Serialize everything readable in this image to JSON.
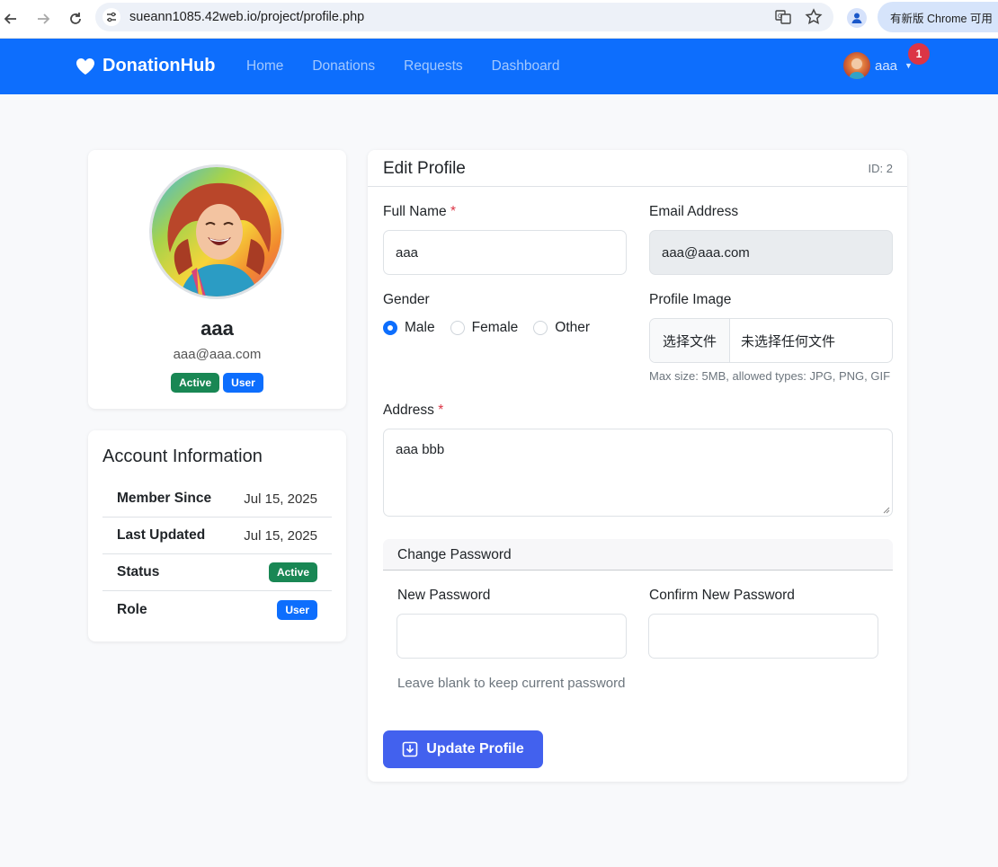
{
  "browser": {
    "url": "sueann1085.42web.io/project/profile.php",
    "update_banner": "有新版 Chrome 可用"
  },
  "navbar": {
    "brand": "DonationHub",
    "links": [
      "Home",
      "Donations",
      "Requests",
      "Dashboard"
    ],
    "username": "aaa",
    "notification_count": "1",
    "color": "#0d6efd"
  },
  "profile": {
    "name": "aaa",
    "email": "aaa@aaa.com",
    "status_badge": "Active",
    "role_badge": "User"
  },
  "account": {
    "title": "Account Information",
    "rows": [
      {
        "label": "Member Since",
        "value": "Jul 15, 2025"
      },
      {
        "label": "Last Updated",
        "value": "Jul 15, 2025"
      },
      {
        "label": "Status",
        "value": "Active"
      },
      {
        "label": "Role",
        "value": "User"
      }
    ]
  },
  "form": {
    "title": "Edit Profile",
    "id_label": "ID: 2",
    "full_name_label": "Full Name",
    "full_name_value": "aaa",
    "email_label": "Email Address",
    "email_value": "aaa@aaa.com",
    "gender_label": "Gender",
    "gender_options": [
      "Male",
      "Female",
      "Other"
    ],
    "gender_selected": "Male",
    "image_label": "Profile Image",
    "file_button": "选择文件",
    "file_none": "未选择任何文件",
    "image_help": "Max size: 5MB, allowed types: JPG, PNG, GIF",
    "address_label": "Address",
    "address_value": "aaa bbb",
    "password_section": "Change Password",
    "new_password_label": "New Password",
    "confirm_password_label": "Confirm New Password",
    "password_help": "Leave blank to keep current password",
    "submit_label": "Update Profile",
    "required_mark": "*"
  },
  "colors": {
    "primary": "#0d6efd",
    "success": "#198754",
    "danger": "#dc3545",
    "submit": "#4261ee"
  }
}
